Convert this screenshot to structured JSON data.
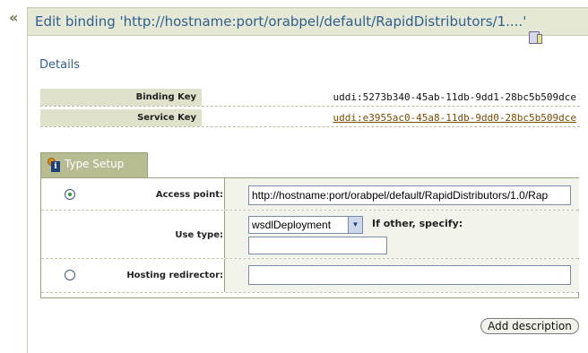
{
  "nav": {
    "back_label": "«"
  },
  "header": {
    "title": "Edit binding 'http://hostname:port/orabpel/default/RapidDistributors/1....'"
  },
  "details": {
    "heading": "Details",
    "rows": [
      {
        "label": "Binding Key",
        "value": "uddi:5273b340-45ab-11db-9dd1-28bc5b509dce",
        "is_link": false
      },
      {
        "label": "Service Key",
        "value": "uddi:e3955ac0-45a8-11db-9dd0-28bc5b509dce",
        "is_link": true
      }
    ]
  },
  "type_setup": {
    "tab_label": "Type Setup",
    "access_point": {
      "label": "Access point:",
      "selected": true,
      "value": "http://hostname:port/orabpel/default/RapidDistributors/1.0/Rap"
    },
    "use_type": {
      "label": "Use type:",
      "selected_option": "wsdlDeployment",
      "other_label": "If other, specify:",
      "other_value": ""
    },
    "hosting_redirector": {
      "label": "Hosting redirector:",
      "selected": false,
      "value": ""
    }
  },
  "actions": {
    "add_description_label": "Add description"
  },
  "colors": {
    "title": "#2f5f8c",
    "tab": "#b7bc93",
    "header_bg": "#e6e8d6"
  }
}
